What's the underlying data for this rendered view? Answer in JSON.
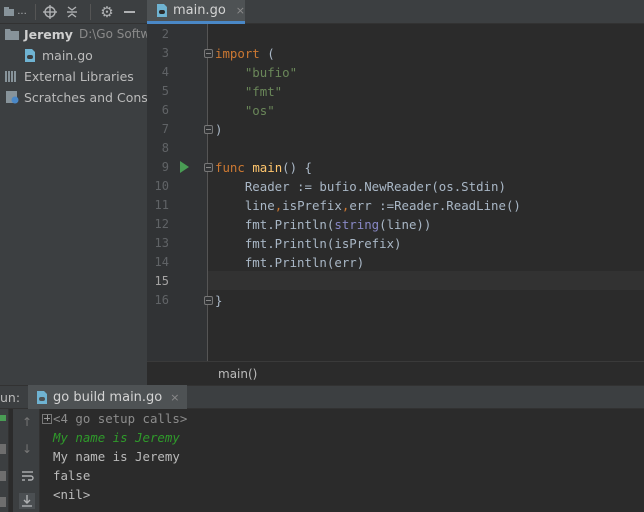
{
  "toolbar": {
    "view_selector": "...",
    "icons": [
      "dropdown-icon",
      "crosshair-icon",
      "collapse-icon",
      "gear-icon",
      "minimize-icon"
    ]
  },
  "editor_tab": {
    "label": "main.go",
    "close": "×"
  },
  "project_tree": {
    "project_name": "Jeremy",
    "project_path": "D:\\Go Softwa",
    "file": "main.go",
    "external_libraries": "External Libraries",
    "scratches": "Scratches and Consol"
  },
  "editor": {
    "line_numbers": [
      "2",
      "3",
      "4",
      "5",
      "6",
      "7",
      "8",
      "9",
      "10",
      "11",
      "12",
      "13",
      "14",
      "15",
      "16"
    ],
    "current_line": "15"
  },
  "breadcrumb": {
    "label": "main()"
  },
  "run_panel": {
    "label": "un:",
    "tab_label": "go build main.go",
    "console": {
      "setup_calls": "<4 go setup calls>",
      "input_line": "My name is Jeremy",
      "output": [
        "My name is Jeremy",
        "false",
        "<nil>"
      ]
    }
  },
  "colors": {
    "background": "#2b2b2b",
    "panel": "#3c3f41",
    "keyword": "#cc7832",
    "string": "#6a8759",
    "function": "#ffc66d",
    "builtin_type": "#8888c6",
    "console_input": "#2f9a2b"
  }
}
